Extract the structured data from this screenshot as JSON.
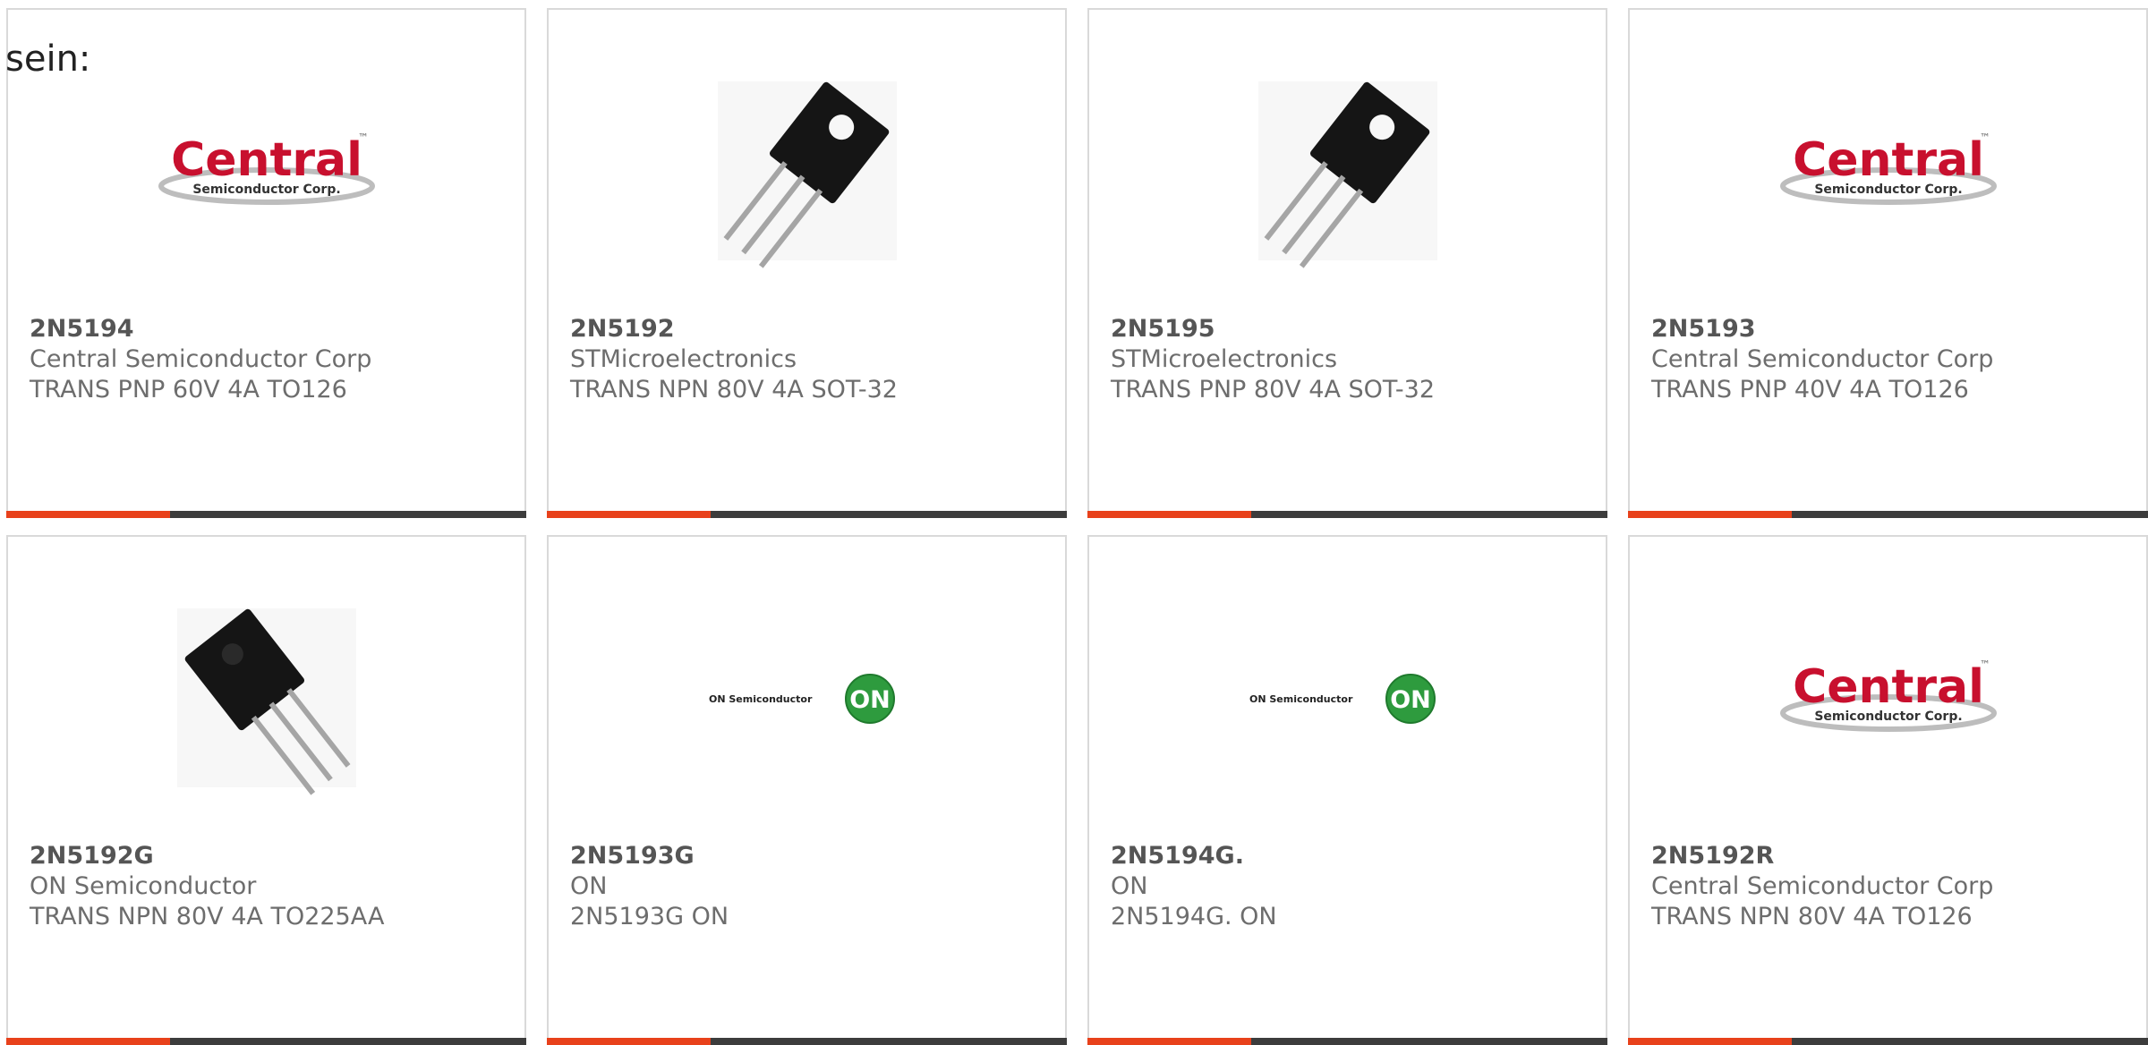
{
  "page": {
    "label": "sein:"
  },
  "products": [
    {
      "part": "2N5194",
      "maker": "Central Semiconductor Corp",
      "description": "TRANS PNP 60V 4A TO126",
      "image": "central-logo"
    },
    {
      "part": "2N5192",
      "maker": "STMicroelectronics",
      "description": "TRANS NPN 80V 4A SOT-32",
      "image": "transistor-photo"
    },
    {
      "part": "2N5195",
      "maker": "STMicroelectronics",
      "description": "TRANS PNP 80V 4A SOT-32",
      "image": "transistor-photo"
    },
    {
      "part": "2N5193",
      "maker": "Central Semiconductor Corp",
      "description": "TRANS PNP 40V 4A TO126",
      "image": "central-logo"
    },
    {
      "part": "2N5192G",
      "maker": "ON Semiconductor",
      "description": "TRANS NPN 80V 4A TO225AA",
      "image": "transistor-photo"
    },
    {
      "part": "2N5193G",
      "maker": "ON",
      "description": "2N5193G ON",
      "image": "on-semiconductor-logo"
    },
    {
      "part": "2N5194G.",
      "maker": "ON",
      "description": "2N5194G. ON",
      "image": "on-semiconductor-logo"
    },
    {
      "part": "2N5192R",
      "maker": "Central Semiconductor Corp",
      "description": "TRANS NPN 80V 4A TO126",
      "image": "central-logo"
    }
  ],
  "logos": {
    "central_word": "Central",
    "central_tm": "™",
    "central_sub": "Semiconductor Corp.",
    "on_text": "ON Semiconductor",
    "on_badge": "ON"
  },
  "colors": {
    "accent_bar": "#e8411b",
    "bar_dark": "#3c3c3c",
    "central_red": "#c8102e",
    "on_green": "#2e9b3e"
  }
}
